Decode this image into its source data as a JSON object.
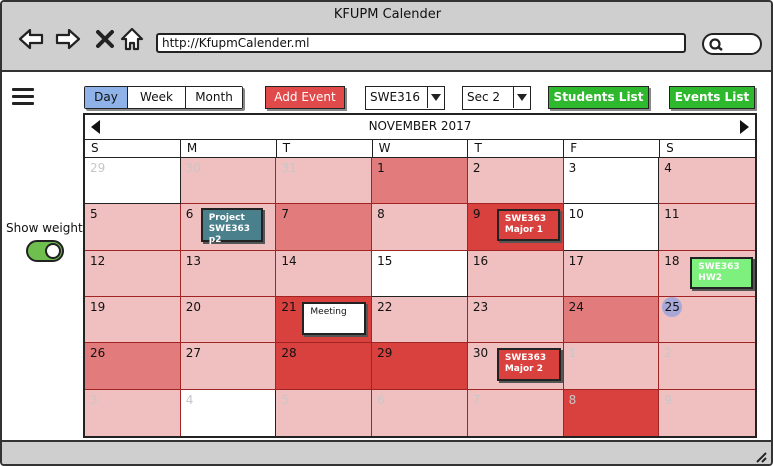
{
  "window": {
    "title": "KFUPM Calender",
    "url": "http://KfupmCalender.ml"
  },
  "toolbar": {
    "view_tabs": [
      "Day",
      "Week",
      "Month"
    ],
    "active_view": "Day",
    "add_event_label": "Add Event",
    "course_select": "SWE316",
    "section_select": "Sec 2",
    "students_list_label": "Students List",
    "events_list_label": "Events List"
  },
  "left_panel": {
    "show_weight_label": "Show weight",
    "show_weight_on": true
  },
  "calendar": {
    "month_label": "NOVEMBER 2017",
    "weekdays": [
      "S",
      "M",
      "T",
      "W",
      "T",
      "F",
      "S"
    ],
    "days": [
      {
        "num": "29",
        "shade": "white",
        "dim": true
      },
      {
        "num": "30",
        "shade": "light",
        "dim": true
      },
      {
        "num": "31",
        "shade": "light",
        "dim": true
      },
      {
        "num": "1",
        "shade": "medium"
      },
      {
        "num": "2",
        "shade": "light"
      },
      {
        "num": "3",
        "shade": "white"
      },
      {
        "num": "4",
        "shade": "light"
      },
      {
        "num": "5",
        "shade": "light"
      },
      {
        "num": "6",
        "shade": "light"
      },
      {
        "num": "7",
        "shade": "medium"
      },
      {
        "num": "8",
        "shade": "light"
      },
      {
        "num": "9",
        "shade": "dark"
      },
      {
        "num": "10",
        "shade": "white"
      },
      {
        "num": "11",
        "shade": "light"
      },
      {
        "num": "12",
        "shade": "light"
      },
      {
        "num": "13",
        "shade": "light"
      },
      {
        "num": "14",
        "shade": "light"
      },
      {
        "num": "15",
        "shade": "white"
      },
      {
        "num": "16",
        "shade": "light"
      },
      {
        "num": "17",
        "shade": "light"
      },
      {
        "num": "18",
        "shade": "light"
      },
      {
        "num": "19",
        "shade": "light"
      },
      {
        "num": "20",
        "shade": "light"
      },
      {
        "num": "21",
        "shade": "dark"
      },
      {
        "num": "22",
        "shade": "light"
      },
      {
        "num": "23",
        "shade": "light"
      },
      {
        "num": "24",
        "shade": "medium"
      },
      {
        "num": "25",
        "shade": "light",
        "today": true
      },
      {
        "num": "26",
        "shade": "medium"
      },
      {
        "num": "27",
        "shade": "light"
      },
      {
        "num": "28",
        "shade": "dark"
      },
      {
        "num": "29",
        "shade": "dark"
      },
      {
        "num": "30",
        "shade": "light"
      },
      {
        "num": "1",
        "shade": "light",
        "dim": true
      },
      {
        "num": "2",
        "shade": "light",
        "dim": true
      },
      {
        "num": "3",
        "shade": "light",
        "dim": true
      },
      {
        "num": "4",
        "shade": "white",
        "dim": true
      },
      {
        "num": "5",
        "shade": "light",
        "dim": true
      },
      {
        "num": "6",
        "shade": "light",
        "dim": true
      },
      {
        "num": "7",
        "shade": "light",
        "dim": true
      },
      {
        "num": "8",
        "shade": "dark",
        "dim": true
      },
      {
        "num": "9",
        "shade": "light",
        "dim": true
      }
    ],
    "events": [
      {
        "label": "Project\nSWE363 p2",
        "day_index": 8,
        "color": "teal"
      },
      {
        "label": "SWE363\nMajor 1",
        "day_index": 11,
        "color": "red"
      },
      {
        "label": "SWE363\nHW2",
        "day_index": 20,
        "color": "green"
      },
      {
        "label": "Meeting",
        "day_index": 23,
        "color": "white"
      },
      {
        "label": "SWE363\nMajor 2",
        "day_index": 32,
        "color": "red"
      }
    ]
  },
  "colors": {
    "light": "#f0c0c0",
    "medium": "#e27c7c",
    "dark": "#d9413f",
    "accent_green": "#2eb82e",
    "active_tab": "#8fb3e8"
  }
}
